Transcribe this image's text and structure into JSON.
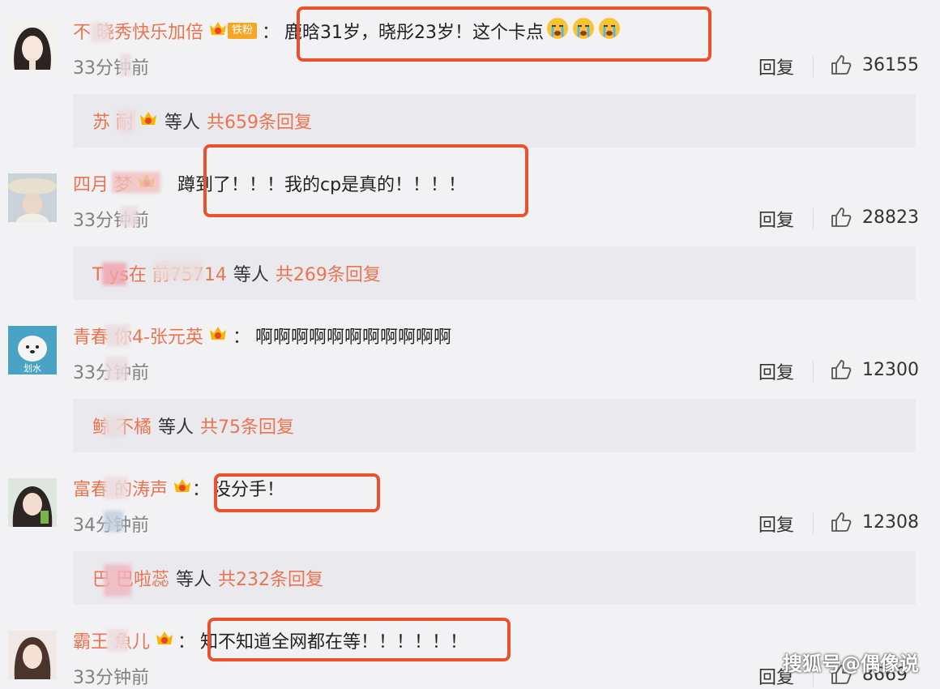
{
  "comments": [
    {
      "username": "不   晓秀快乐加倍",
      "crown_level": "2",
      "fan_badge": "铁粉",
      "text": "鹿晗31岁，晓彤23岁！这个卡点",
      "emoji_count": 3,
      "time": "33分钟前",
      "reply_label": "回复",
      "likes": "36155",
      "reply_summary": {
        "name": "苏 耐",
        "crown_level": "2",
        "etc": "等人",
        "total": "共659条回复"
      }
    },
    {
      "username": "四月     梦",
      "crown_level": "5",
      "text": "蹲到了！！！我的cp是真的！！！！",
      "time": "33分钟前",
      "reply_label": "回复",
      "likes": "28823",
      "reply_summary": {
        "name": "T  ys在  前75714",
        "etc": "等人",
        "total": "共269条回复"
      }
    },
    {
      "username": "青春   你4-张元英",
      "crown_level": "4",
      "text": "啊啊啊啊啊啊啊啊啊啊啊",
      "avatar_caption": "划水",
      "time": "33分钟前",
      "reply_label": "回复",
      "likes": "12300",
      "reply_summary": {
        "name": "鲸  不橘",
        "etc": "等人",
        "total": "共75条回复"
      }
    },
    {
      "username": "富春   的涛声",
      "crown_level": "",
      "text": "没分手！",
      "time": "34分钟前",
      "reply_label": "回复",
      "likes": "12308",
      "reply_summary": {
        "name": "巴  巴啦蕊",
        "etc": "等人",
        "total": "共232条回复"
      }
    },
    {
      "username": "霸王   魚儿",
      "crown_level": "5",
      "text": "知不知道全网都在等！！！！！！",
      "time": "33分钟前",
      "reply_label": "回复",
      "likes": "8669"
    }
  ],
  "watermark": "搜狐号@偶像说",
  "colors": {
    "username": "#eb7350",
    "highlight": "#e8532d",
    "reply_bar": "#eaeaee"
  }
}
